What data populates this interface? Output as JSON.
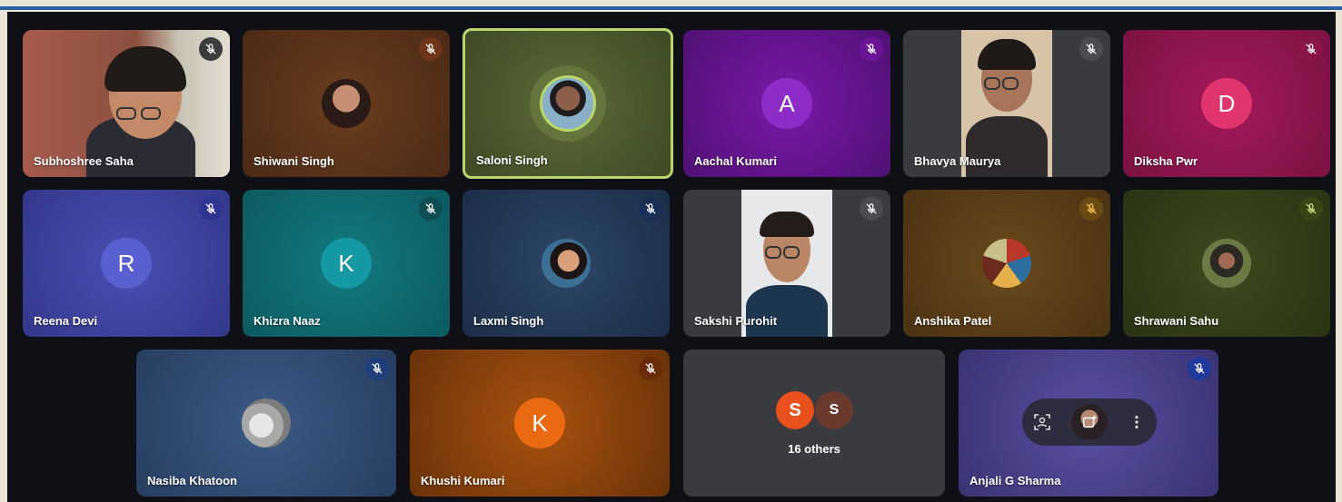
{
  "meeting": {
    "participants": [
      {
        "name": "Subhoshree Saha",
        "muted": true,
        "video": true
      },
      {
        "name": "Shiwani Singh",
        "muted": true
      },
      {
        "name": "Saloni Singh",
        "speaking": true
      },
      {
        "name": "Aachal Kumari",
        "muted": true,
        "initial": "A"
      },
      {
        "name": "Bhavya Maurya",
        "muted": true,
        "video": true
      },
      {
        "name": "Diksha Pwr",
        "muted": true,
        "initial": "D"
      },
      {
        "name": "Reena Devi",
        "muted": true,
        "initial": "R"
      },
      {
        "name": "Khizra Naaz",
        "muted": true,
        "initial": "K"
      },
      {
        "name": "Laxmi Singh",
        "muted": true
      },
      {
        "name": "Sakshi Purohit",
        "muted": true,
        "video": true
      },
      {
        "name": "Anshika Patel",
        "muted": true
      },
      {
        "name": "Shrawani Sahu",
        "muted": true
      },
      {
        "name": "Nasiba Khatoon",
        "muted": true
      },
      {
        "name": "Khushi Kumari",
        "muted": true,
        "initial": "K"
      },
      {
        "name": "Anjali G Sharma",
        "muted": true
      }
    ],
    "others": {
      "label": "16 others",
      "avatars": [
        "S",
        "S"
      ]
    }
  },
  "colors": {
    "speaking_border": "#b9d66b",
    "mute_icon": "#ffffff"
  },
  "icons": [
    "mic-off-icon",
    "framing-icon",
    "add-photo-icon",
    "more-vert-icon"
  ]
}
